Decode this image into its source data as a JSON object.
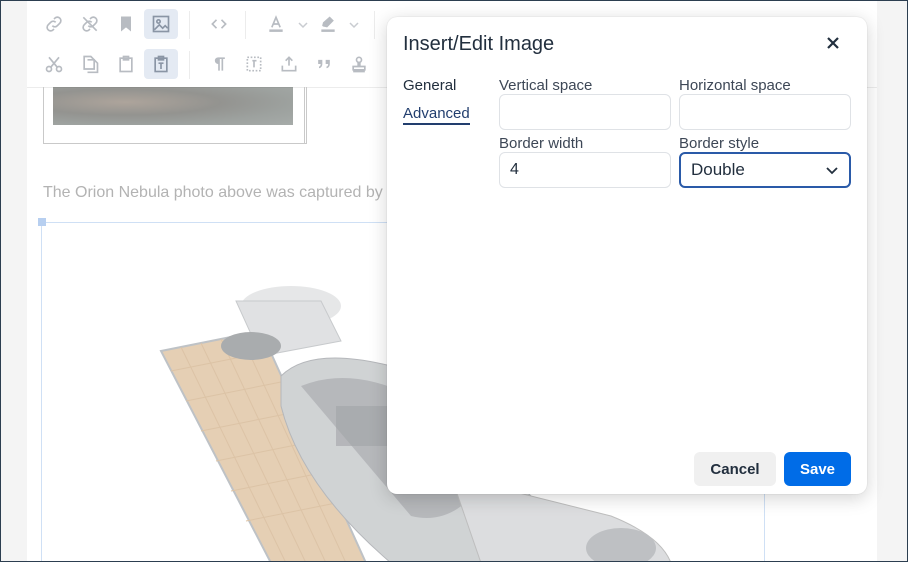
{
  "editor": {
    "caption": "The Orion Nebula photo above was captured by"
  },
  "toolbar": {
    "row1_icons": [
      "link-icon",
      "unlink-icon",
      "bookmark-icon",
      "image-icon",
      "code-icon",
      "text-color-icon",
      "highlight-color-icon"
    ],
    "row2_icons": [
      "cut-icon",
      "copy-icon",
      "paste-icon",
      "paste-text-icon",
      "paragraph-icon",
      "visual-blocks-icon",
      "upload-icon",
      "blockquote-icon",
      "stamp-icon"
    ]
  },
  "dialog": {
    "title": "Insert/Edit Image",
    "tabs": [
      {
        "label": "General",
        "active": false
      },
      {
        "label": "Advanced",
        "active": true
      }
    ],
    "fields": {
      "vertical_space": {
        "label": "Vertical space",
        "value": ""
      },
      "horizontal_space": {
        "label": "Horizontal space",
        "value": ""
      },
      "border_width": {
        "label": "Border width",
        "value": "4"
      },
      "border_style": {
        "label": "Border style",
        "value": "Double"
      }
    },
    "buttons": {
      "cancel": "Cancel",
      "save": "Save"
    }
  },
  "colors": {
    "accent": "#006ce7",
    "focus_border": "#2a5aa8",
    "text": "#222f3e"
  }
}
